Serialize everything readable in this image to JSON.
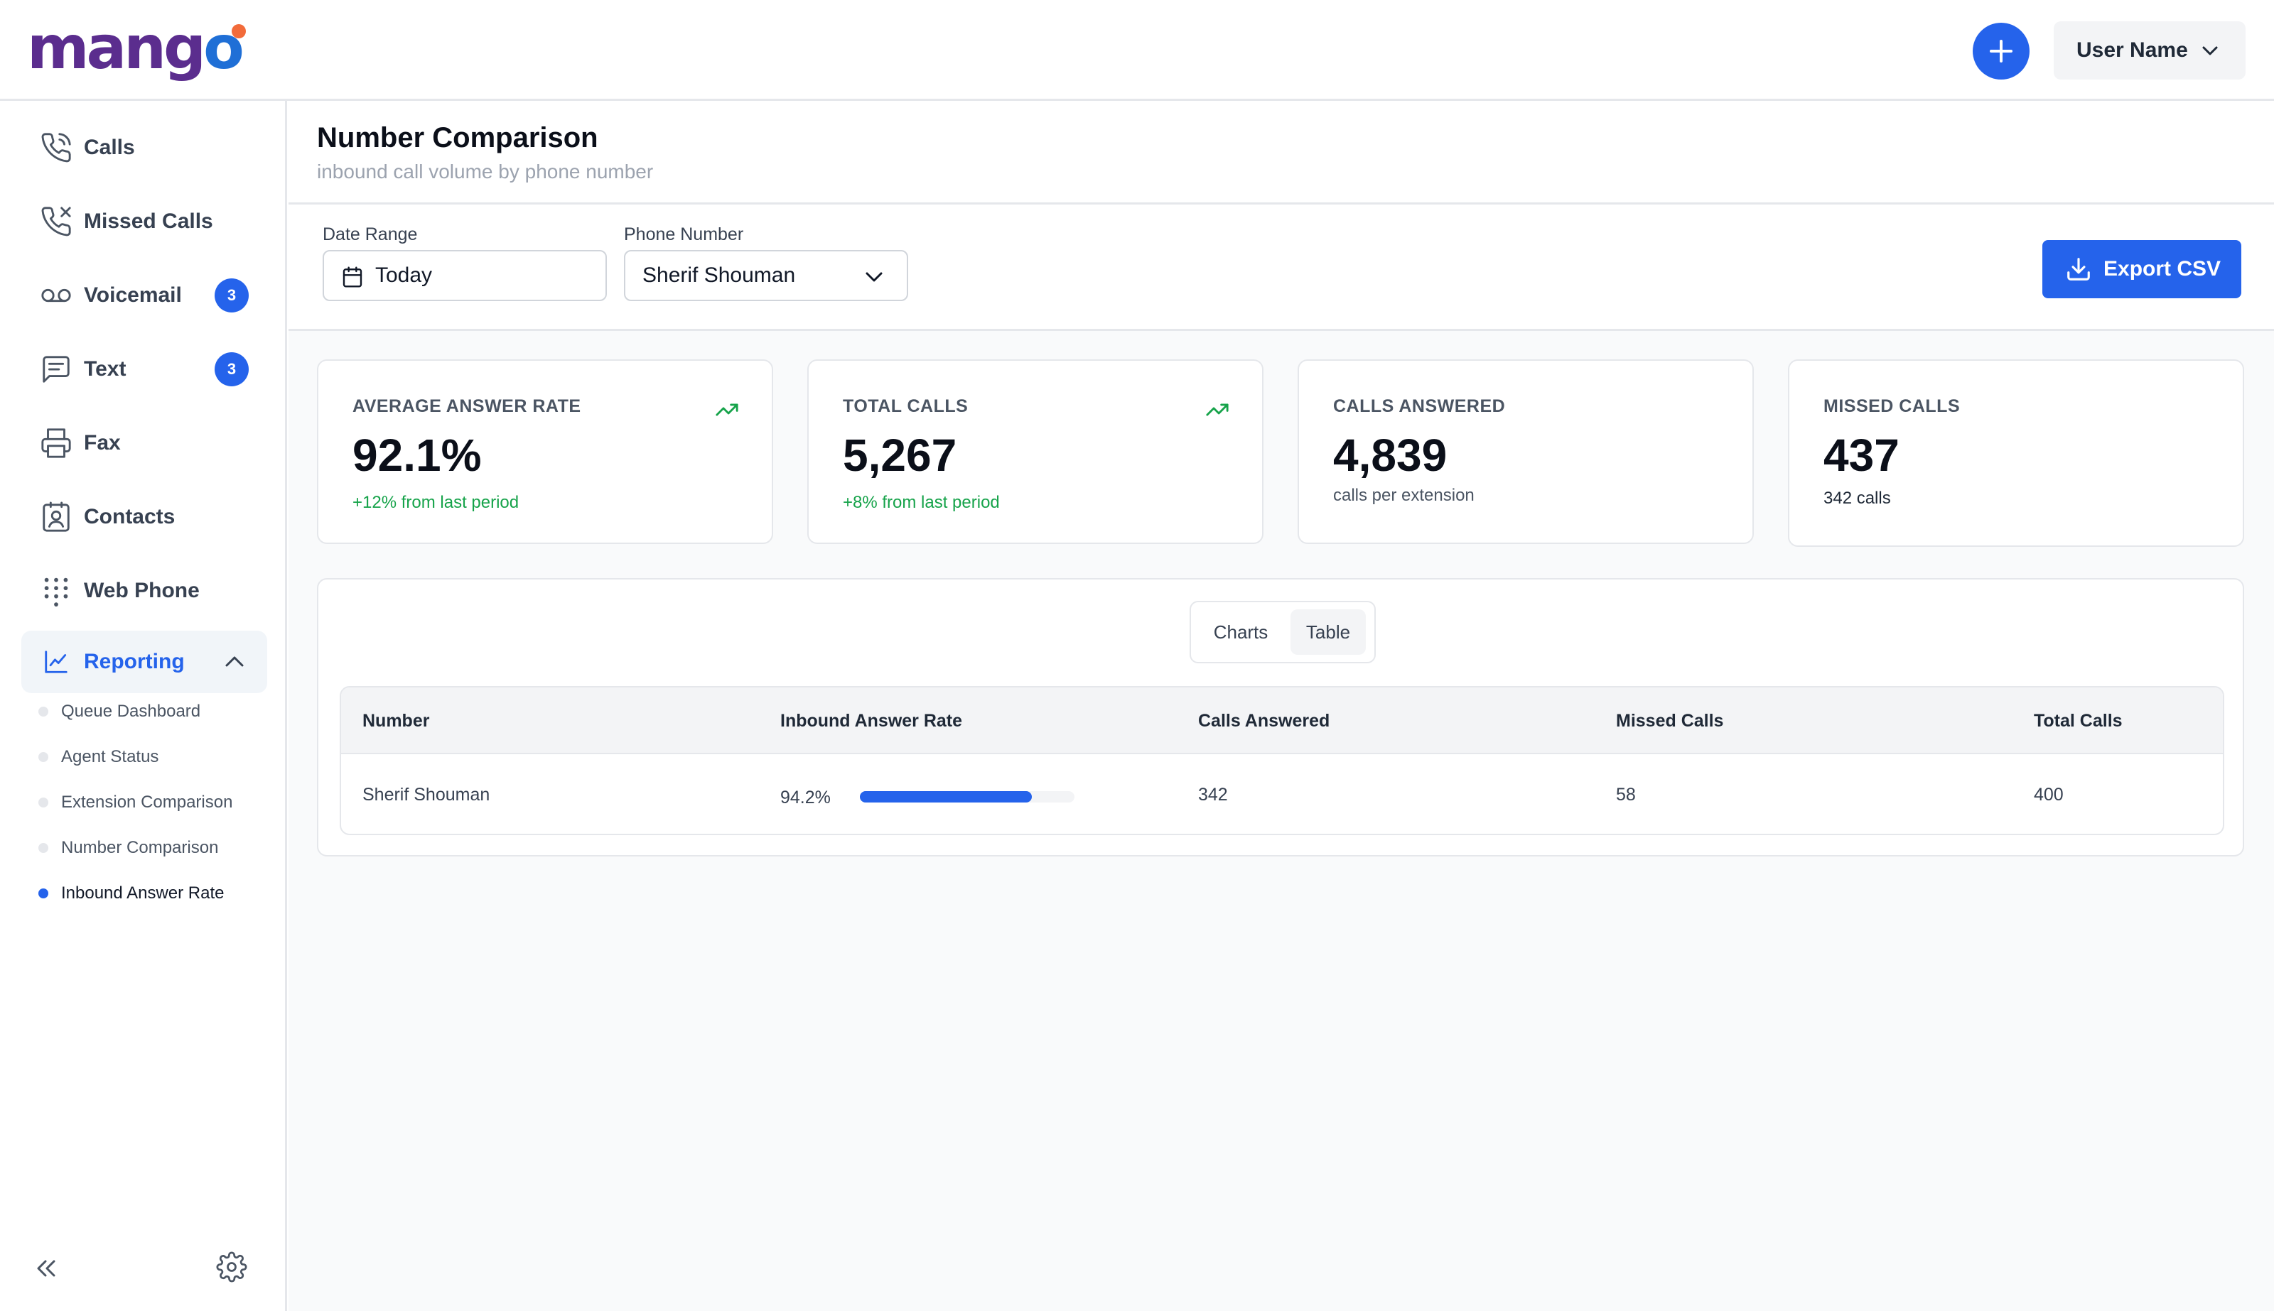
{
  "header": {
    "logo_text": "mango",
    "add_button_label": "+",
    "user_name": "User Name"
  },
  "sidebar": {
    "items": [
      {
        "label": "Calls",
        "icon": "phone-icon"
      },
      {
        "label": "Missed Calls",
        "icon": "missed-call-icon"
      },
      {
        "label": "Voicemail",
        "icon": "voicemail-icon",
        "badge": "3"
      },
      {
        "label": "Text",
        "icon": "message-icon",
        "badge": "3"
      },
      {
        "label": "Fax",
        "icon": "printer-icon"
      },
      {
        "label": "Contacts",
        "icon": "contact-card-icon"
      },
      {
        "label": "Web Phone",
        "icon": "dialpad-icon"
      },
      {
        "label": "Reporting",
        "icon": "line-chart-icon",
        "active": true
      }
    ],
    "reporting_subitems": [
      {
        "label": "Queue Dashboard"
      },
      {
        "label": "Agent Status"
      },
      {
        "label": "Extension Comparison"
      },
      {
        "label": "Number Comparison"
      },
      {
        "label": "Inbound Answer Rate",
        "active": true
      }
    ]
  },
  "page": {
    "title": "Number Comparison",
    "subtitle": "inbound call volume by phone number"
  },
  "filters": {
    "date_range_label": "Date Range",
    "date_range_value": "Today",
    "phone_number_label": "Phone Number",
    "phone_number_value": "Sherif Shouman",
    "export_label": "Export CSV"
  },
  "stats": [
    {
      "title": "AVERAGE ANSWER RATE",
      "value": "92.1%",
      "sub": "+12% from last period",
      "trend": "up"
    },
    {
      "title": "TOTAL CALLS",
      "value": "5,267",
      "sub": "+8% from last period",
      "trend": "up"
    },
    {
      "title": "CALLS ANSWERED",
      "value": "4,839",
      "sub": "calls per extension"
    },
    {
      "title": "MISSED CALLS",
      "value": "437",
      "sub": "342 calls"
    }
  ],
  "view_toggle": {
    "options": [
      "Charts",
      "Table"
    ],
    "selected": "Table"
  },
  "table": {
    "columns": [
      "Number",
      "Inbound Answer Rate",
      "Calls Answered",
      "Missed Calls",
      "Total Calls"
    ],
    "rows": [
      {
        "number": "Sherif Shouman",
        "answer_rate": "94.2%",
        "answer_rate_fraction": 0.8,
        "calls_answered": "342",
        "missed_calls": "58",
        "total_calls": "400"
      }
    ]
  },
  "colors": {
    "accent": "#2563eb",
    "positive": "#16a34a",
    "logo_purple": "#5b2d8e",
    "logo_blue": "#1f6fd6",
    "logo_orange": "#f26b3a"
  }
}
